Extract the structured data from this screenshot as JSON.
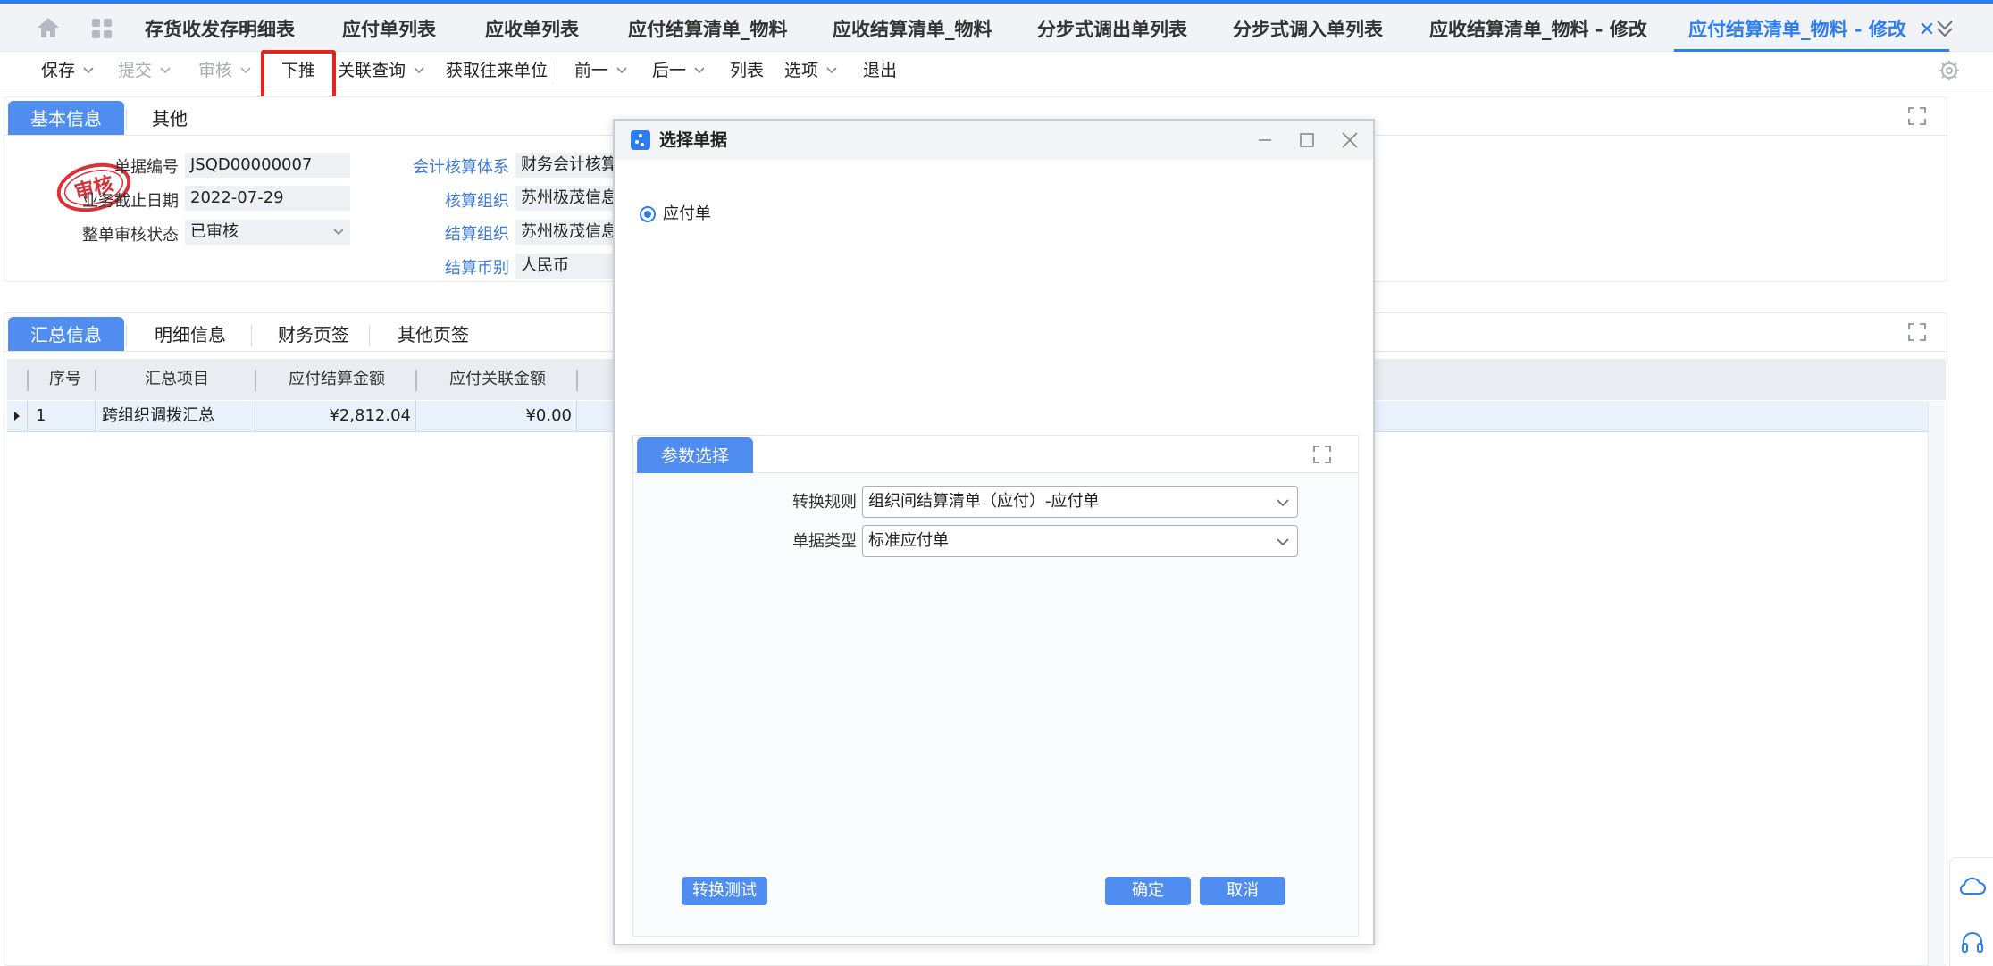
{
  "tabs": [
    {
      "label": "存货收发存明细表"
    },
    {
      "label": "应付单列表"
    },
    {
      "label": "应收单列表"
    },
    {
      "label": "应付结算清单_物料"
    },
    {
      "label": "应收结算清单_物料"
    },
    {
      "label": "分步式调出单列表"
    },
    {
      "label": "分步式调入单列表"
    },
    {
      "label": "应收结算清单_物料 - 修改"
    },
    {
      "label": "应付结算清单_物料 - 修改",
      "close": "✕"
    }
  ],
  "toolbar": {
    "save": "保存",
    "submit": "提交",
    "audit": "审核",
    "push_down": "下推",
    "related_query": "关联查询",
    "get_partner": "获取往来单位",
    "prev": "前一",
    "next": "后一",
    "list": "列表",
    "options": "选项",
    "exit": "退出"
  },
  "basic_panel": {
    "tabs": [
      "基本信息",
      "其他"
    ],
    "stamp_text": "审核",
    "fields": {
      "bill_no_label": "单据编号",
      "bill_no": "JSQD00000007",
      "end_date_label": "业务截止日期",
      "end_date": "2022-07-29",
      "status_label": "整单审核状态",
      "status": "已审核",
      "acct_system_label": "会计核算体系",
      "acct_system": "财务会计核算",
      "acct_org_label": "核算组织",
      "acct_org": "苏州极茂信息",
      "settle_org_label": "结算组织",
      "settle_org": "苏州极茂信息",
      "currency_label": "结算币别",
      "currency": "人民币"
    }
  },
  "detail_panel": {
    "tabs": [
      "汇总信息",
      "明细信息",
      "财务页签",
      "其他页签"
    ],
    "columns": [
      "序号",
      "汇总项目",
      "应付结算金额",
      "应付关联金额"
    ],
    "rows": [
      {
        "seq": "1",
        "item": "跨组织调拨汇总",
        "amount": "¥2,812.04",
        "related": "¥0.00"
      }
    ]
  },
  "dialog": {
    "title": "选择单据",
    "radio_option": "应付单",
    "param_tab": "参数选择",
    "rule_label": "转换规则",
    "rule_value": "组织间结算清单（应付）-应付单",
    "type_label": "单据类型",
    "type_value": "标准应付单",
    "test_button": "转换测试",
    "ok_button": "确定",
    "cancel_button": "取消"
  },
  "colors": {
    "accent": "#2d7cf0",
    "button": "#4f8ef0",
    "highlight_box": "#e1251b",
    "stamp": "#d9303a"
  }
}
